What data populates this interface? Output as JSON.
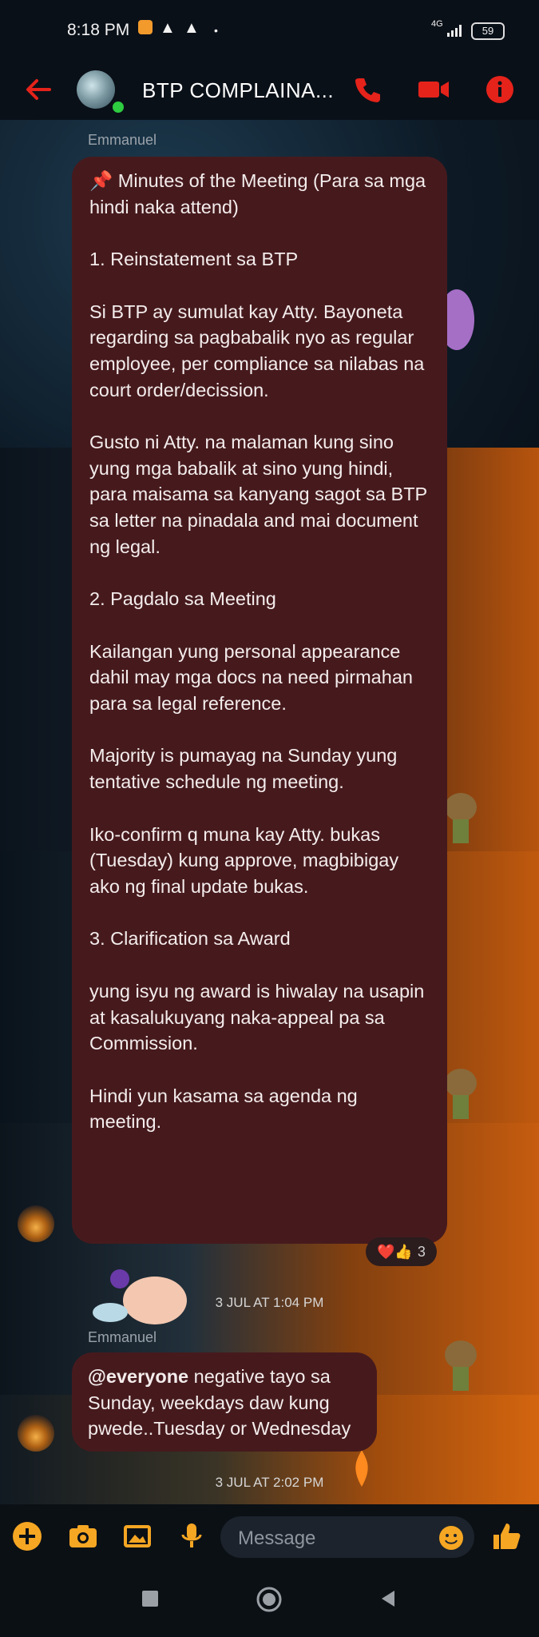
{
  "status_bar": {
    "time": "8:18 PM",
    "network": "4G",
    "battery": "59"
  },
  "header": {
    "title": "BTP COMPLAINA...",
    "back_icon": "arrow-left-icon",
    "call_icon": "phone-icon",
    "video_icon": "video-camera-icon",
    "info_icon": "info-icon",
    "accent": "#e5231b"
  },
  "messages": [
    {
      "sender": "Emmanuel",
      "text": "📌 Minutes of the Meeting (Para sa mga hindi naka attend)\n\n1. Reinstatement sa BTP\n\nSi BTP ay sumulat kay Atty. Bayoneta regarding sa pagbabalik nyo as regular employee, per compliance sa nilabas na court order/decission.\n\nGusto ni Atty. na malaman kung sino yung mga babalik at sino yung hindi, para maisama sa kanyang sagot sa BTP sa letter na pinadala and mai document ng legal.\n\n2. Pagdalo sa Meeting\n\nKailangan yung personal appearance dahil may mga docs na need pirmahan para sa legal reference.\n\nMajority is pumayag na Sunday yung tentative schedule ng meeting.\n\nIko-confirm q muna kay Atty. bukas (Tuesday) kung approve, magbibigay ako ng final update bukas.\n\n3. Clarification sa Award\n\nyung isyu ng award is hiwalay na usapin at kasalukuyang naka-appeal pa sa Commission.\n\nHindi yun kasama sa agenda ng meeting.",
      "reactions": {
        "emojis": "❤️👍",
        "count": "3"
      }
    },
    {
      "timestamp": "3 JUL AT 1:04 PM"
    },
    {
      "sender": "Emmanuel",
      "mention": "@everyone",
      "text": " negative tayo sa Sunday, weekdays daw kung pwede..Tuesday or Wednesday"
    },
    {
      "timestamp": "3 JUL AT 2:02 PM"
    }
  ],
  "composer": {
    "placeholder": "Message",
    "icons": [
      "plus-icon",
      "camera-icon",
      "image-icon",
      "microphone-icon",
      "emoji-icon",
      "thumbs-up-icon"
    ]
  },
  "nav": {
    "icons": [
      "recents-square-icon",
      "home-circle-icon",
      "back-triangle-icon"
    ]
  }
}
